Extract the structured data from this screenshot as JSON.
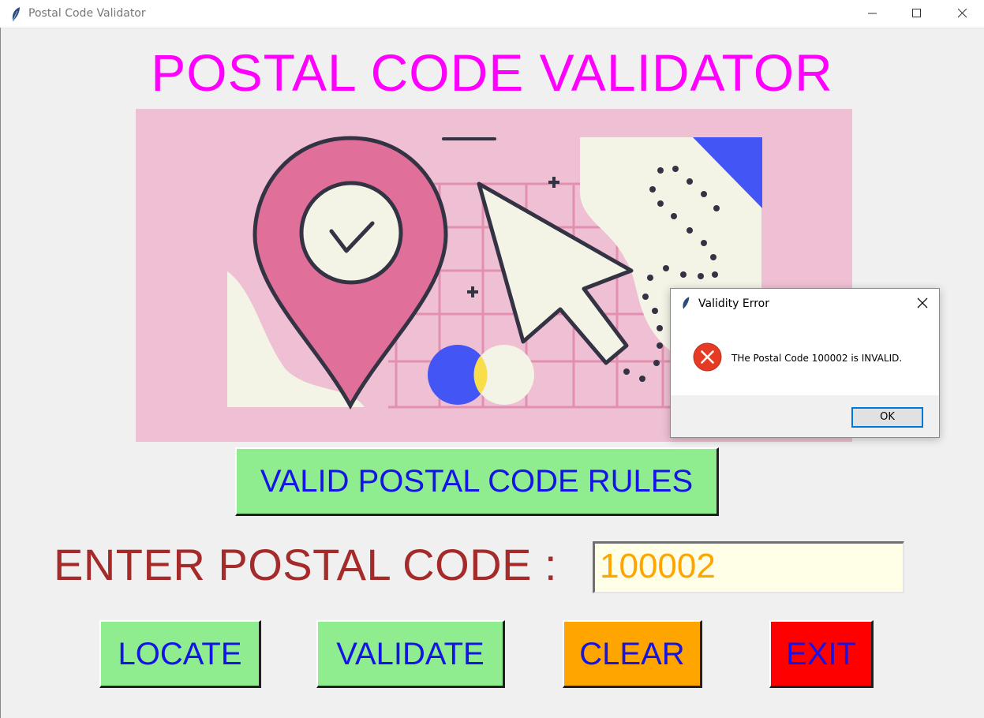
{
  "window": {
    "title": "Postal Code Validator",
    "icon": "feather-icon"
  },
  "heading": "POSTAL CODE VALIDATOR",
  "banner": {
    "icon": "location-pin-check-illustration"
  },
  "buttons": {
    "rules": "VALID POSTAL CODE RULES",
    "locate": "LOCATE",
    "validate": "VALIDATE",
    "clear": "CLEAR",
    "exit": "EXIT"
  },
  "form": {
    "label": "ENTER POSTAL CODE :",
    "postal_code_value": "100002"
  },
  "dialog": {
    "title": "Validity Error",
    "message": "THe Postal Code 100002 is INVALID.",
    "ok_label": "OK",
    "icon": "error-icon"
  },
  "colors": {
    "heading": "#ff00ff",
    "label": "#a52a2a",
    "button_text": "#1414e6",
    "green_button": "#8fec8f",
    "clear_button": "#ffa500",
    "exit_button": "#ff0000",
    "input_text": "#ffa500",
    "input_bg": "#fffee6"
  }
}
